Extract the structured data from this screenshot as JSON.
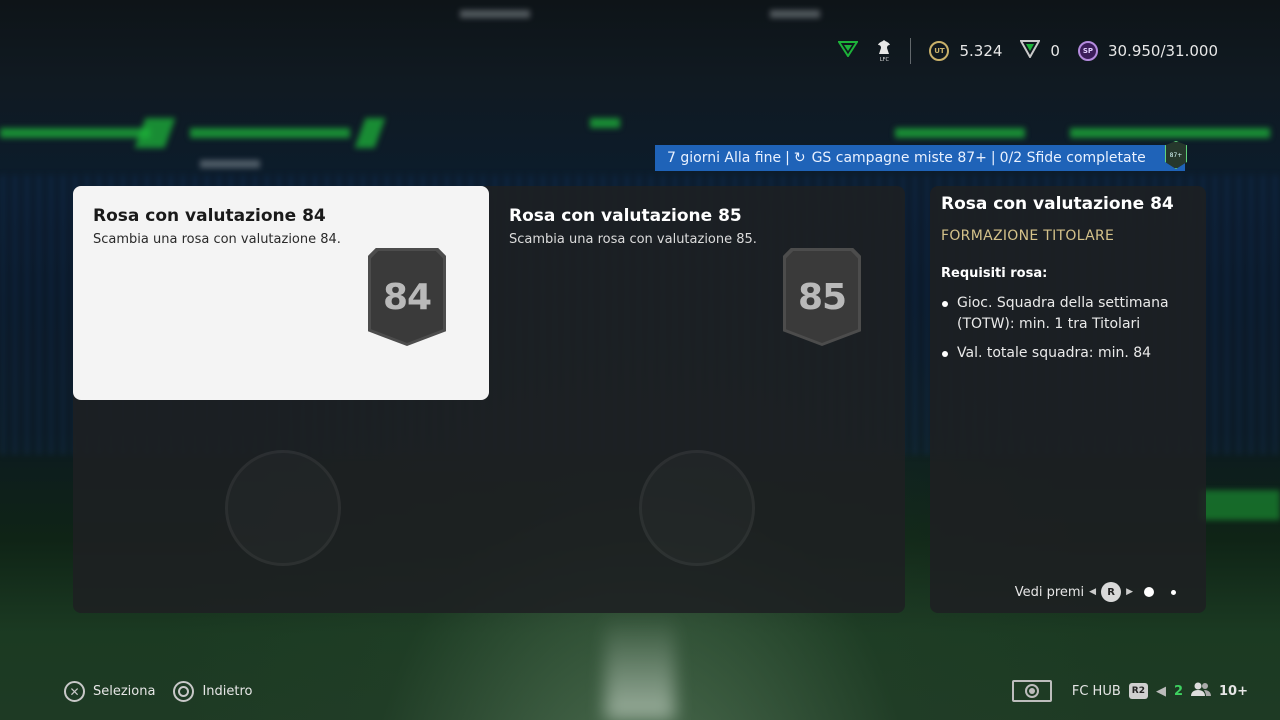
{
  "topbar": {
    "currency1_value": "5.324",
    "currency1_icon": "fc-coin-icon",
    "currency2_value": "0",
    "currency2_icon": "fc-points-icon",
    "sp_value": "30.950/31.000",
    "sp_label": "SP",
    "club_short": "LFC",
    "accent_color": "#1db33a"
  },
  "banner": {
    "days_text": "7 giorni Alla fine",
    "campaign_text": "GS campagne miste 87+",
    "progress_text": "0/2 Sfide completate",
    "badge_text": "87+",
    "color": "#1f63b8"
  },
  "cards": [
    {
      "title": "Rosa con valutazione 84",
      "subtitle": "Scambia una rosa con valutazione 84.",
      "rating": "84",
      "selected": true
    },
    {
      "title": "Rosa con valutazione 85",
      "subtitle": "Scambia una rosa con valutazione 85.",
      "rating": "85",
      "selected": false
    }
  ],
  "side_panel": {
    "title": "Rosa con valutazione 84",
    "subtitle": "FORMAZIONE TITOLARE",
    "requirements_label": "Requisiti rosa:",
    "requirements": [
      "Gioc. Squadra della settimana (TOTW): min. 1 tra Titolari",
      "Val. totale squadra: min. 84"
    ],
    "rewards_label": "Vedi premi",
    "rewards_button": "R",
    "page_indicator": {
      "current": 1,
      "total": 2
    }
  },
  "footer": {
    "select_label": "Seleziona",
    "back_label": "Indietro",
    "hub_label": "FC HUB",
    "r2_label": "R2",
    "notif_count": "2",
    "friends_count": "10+"
  }
}
